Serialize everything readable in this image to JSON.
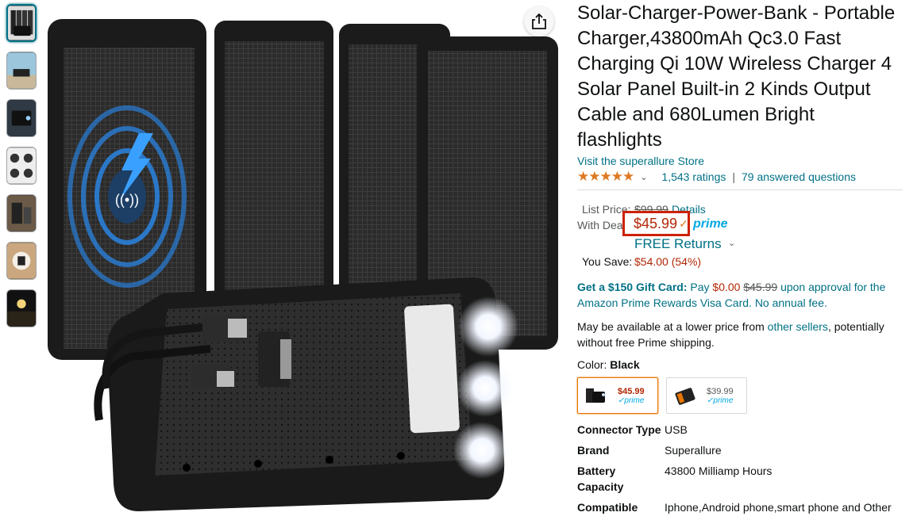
{
  "product": {
    "title": "Solar-Charger-Power-Bank - Portable Charger,43800mAh Qc3.0 Fast Charging Qi 10W Wireless Charger 4 Solar Panel Built-in 2 Kinds Output Cable and 680Lumen Bright flashlights",
    "store_link": "Visit the superallure Store",
    "stars": "★★★★★",
    "rating_fraction": 0.9,
    "ratings_count": "1,543 ratings",
    "separator": "|",
    "answered": "79 answered questions"
  },
  "price": {
    "list_label": "List Price:",
    "list_value": "$99.99",
    "details_link": "Details",
    "deal_label": "With Deal:",
    "deal_price": "$45.99",
    "check": "✓",
    "prime": "prime",
    "free_returns": "FREE Returns",
    "save_label": "You Save:",
    "save_value": "$54.00 (54%)"
  },
  "gift": {
    "bold": "Get a $150 Gift Card:",
    "pay": "Pay",
    "pay_amount": "$0.00",
    "old_amount": "$45.99",
    "rest": "upon approval for the Amazon Prime Rewards Visa Card. No annual fee."
  },
  "availability": {
    "pre": "May be available at a lower price from",
    "link": "other sellers",
    "post": ", potentially without free Prime shipping."
  },
  "color": {
    "label": "Color:",
    "value": "Black",
    "options": [
      {
        "price": "$45.99",
        "prime": "✓prime"
      },
      {
        "price": "$39.99",
        "prime": "✓prime"
      }
    ]
  },
  "specs": [
    {
      "key": "Connector Type",
      "value": "USB"
    },
    {
      "key": "Brand",
      "value": "Superallure"
    },
    {
      "key": "Battery Capacity",
      "value": "43800 Milliamp Hours"
    },
    {
      "key": "Compatible",
      "value": "Iphone,Android phone,smart phone and Other"
    }
  ],
  "icons": {
    "share": "share-icon",
    "chevron": "chevron-down-icon"
  },
  "colors": {
    "link": "#007185",
    "price_red": "#b12704",
    "highlight_box": "#cc2200",
    "star": "#de7921",
    "prime_blue": "#00a8e1"
  }
}
